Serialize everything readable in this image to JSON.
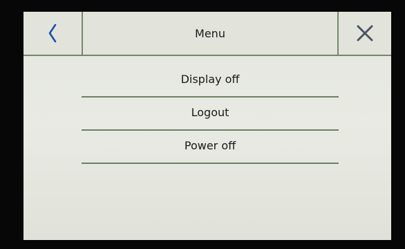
{
  "header": {
    "title": "Menu",
    "back_icon": "chevron-left-icon",
    "close_icon": "close-icon"
  },
  "menu": {
    "items": [
      {
        "label": "Display off"
      },
      {
        "label": "Logout"
      },
      {
        "label": "Power off"
      }
    ]
  },
  "colors": {
    "screen_background": "#e4e6df",
    "divider": "#75876a",
    "back_icon": "#1f4fa6",
    "close_icon": "#4a5562",
    "text": "#1a1a1a"
  }
}
